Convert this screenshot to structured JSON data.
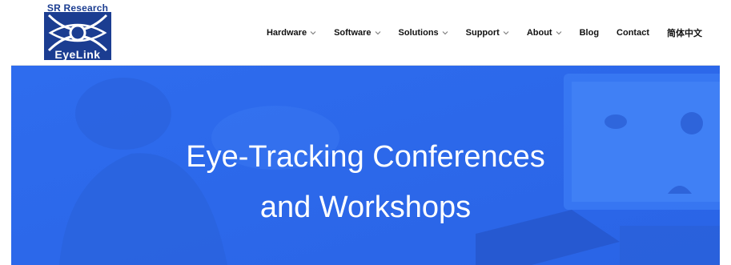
{
  "logo": {
    "top_text": "SR Research",
    "bottom_text": "EyeLink"
  },
  "nav": {
    "items": [
      {
        "label": "Hardware",
        "has_dropdown": true
      },
      {
        "label": "Software",
        "has_dropdown": true
      },
      {
        "label": "Solutions",
        "has_dropdown": true
      },
      {
        "label": "Support",
        "has_dropdown": true
      },
      {
        "label": "About",
        "has_dropdown": true
      },
      {
        "label": "Blog",
        "has_dropdown": false
      },
      {
        "label": "Contact",
        "has_dropdown": false
      },
      {
        "label": "简体中文",
        "has_dropdown": false
      }
    ]
  },
  "hero": {
    "title_line1": "Eye-Tracking Conferences",
    "title_line2": "and Workshops"
  },
  "colors": {
    "brand_navy": "#1b3d91",
    "hero_blue": "#2f6ff0",
    "nav_text": "#111111"
  }
}
